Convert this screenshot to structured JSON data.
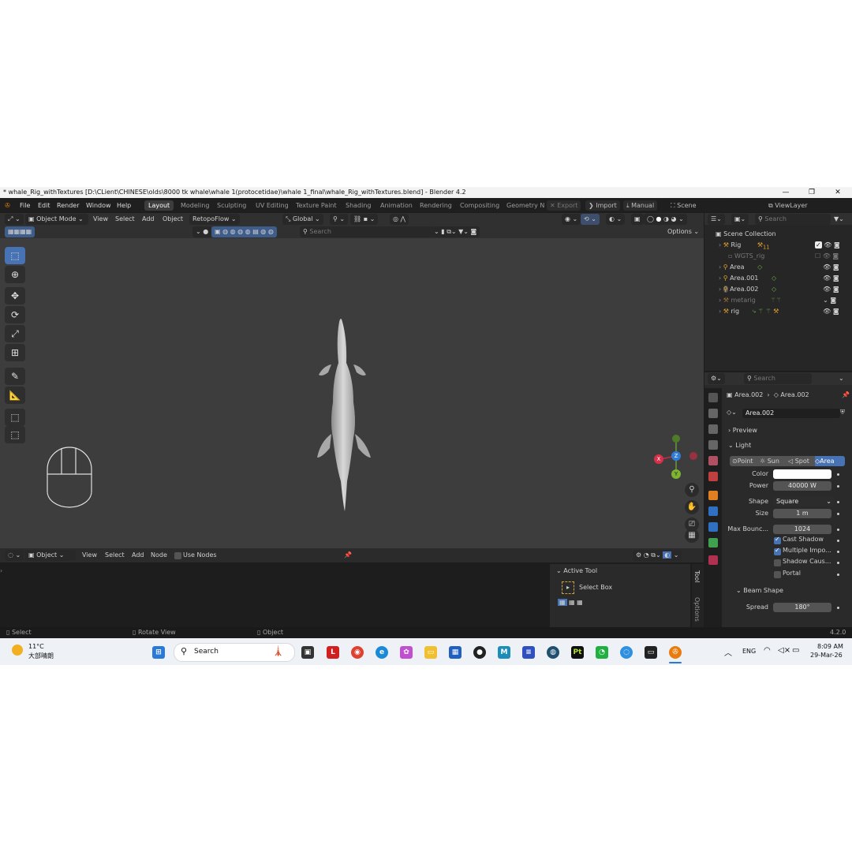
{
  "window": {
    "title": "* whale_Rig_withTextures [D:\\CLient\\CHINESE\\olds\\8000 tk whale\\whale 1(protocetidae)\\whale 1_final\\whale_Rig_withTextures.blend] - Blender 4.2",
    "minimize": "—",
    "maximize": "❐",
    "close": "✕"
  },
  "menu": [
    "File",
    "Edit",
    "Render",
    "Window",
    "Help"
  ],
  "workspaces": [
    "Layout",
    "Modeling",
    "Sculpting",
    "UV Editing",
    "Texture Paint",
    "Shading",
    "Animation",
    "Rendering",
    "Compositing",
    "Geometry N"
  ],
  "topbar": {
    "export": "Export",
    "import": "Import",
    "manual": "Manual",
    "scene": "Scene",
    "viewlayer": "ViewLayer"
  },
  "viewport": {
    "mode": "Object Mode",
    "menus": [
      "View",
      "Select",
      "Add",
      "Object"
    ],
    "addon": "RetopoFlow",
    "transform": "Global",
    "search_placeholder": "Search",
    "options": "Options"
  },
  "gizmo": {
    "x": "X",
    "y": "Y",
    "z": "Z"
  },
  "node_editor": {
    "type": "Object",
    "menus": [
      "View",
      "Select",
      "Add",
      "Node"
    ],
    "use_nodes": "Use Nodes",
    "active_tool_title": "Active Tool",
    "active_tool_name": "Select Box",
    "side_tabs": [
      "Tool",
      "Options"
    ]
  },
  "outliner": {
    "search_placeholder": "Search",
    "root": "Scene Collection",
    "items": [
      {
        "name": "Rig",
        "dim": false,
        "checkbox": true
      },
      {
        "name": "WGTS_rig",
        "dim": true,
        "checkbox": true
      },
      {
        "name": "Area",
        "dim": false,
        "checkbox": false
      },
      {
        "name": "Area.001",
        "dim": false,
        "checkbox": false
      },
      {
        "name": "Area.002",
        "dim": false,
        "checkbox": false
      },
      {
        "name": "metarig",
        "dim": true,
        "checkbox": false
      },
      {
        "name": "rig",
        "dim": false,
        "checkbox": false
      }
    ],
    "rig_badge": "11"
  },
  "properties": {
    "search_placeholder": "Search",
    "breadcrumb_object": "Area.002",
    "breadcrumb_data": "Area.002",
    "datablock": "Area.002",
    "preview": "Preview",
    "light": "Light",
    "light_types": [
      "Point",
      "Sun",
      "Spot",
      "Area"
    ],
    "active_light_type": "Area",
    "fields": {
      "color_label": "Color",
      "power_label": "Power",
      "power": "40000 W",
      "shape_label": "Shape",
      "shape": "Square",
      "size_label": "Size",
      "size": "1 m",
      "bounce_label": "Max Bounc...",
      "bounce": "1024"
    },
    "checks": [
      {
        "label": "Cast Shadow",
        "on": true
      },
      {
        "label": "Multiple Impo...",
        "on": true
      },
      {
        "label": "Shadow Caus...",
        "on": false
      },
      {
        "label": "Portal",
        "on": false
      }
    ],
    "beam_shape": "Beam Shape",
    "spread_label": "Spread",
    "spread": "180°"
  },
  "status": {
    "select": "Select",
    "rotate": "Rotate View",
    "object": "Object",
    "version": "4.2.0"
  },
  "taskbar": {
    "weather_temp": "11°C",
    "weather_desc": "大部晴朗",
    "search": "Search",
    "lang": "ENG",
    "time": "8:09 AM",
    "date": "29-Mar-26"
  },
  "colors": {
    "accent": "#4772b3",
    "viewport": "#3d3d3d",
    "header": "#303030"
  }
}
